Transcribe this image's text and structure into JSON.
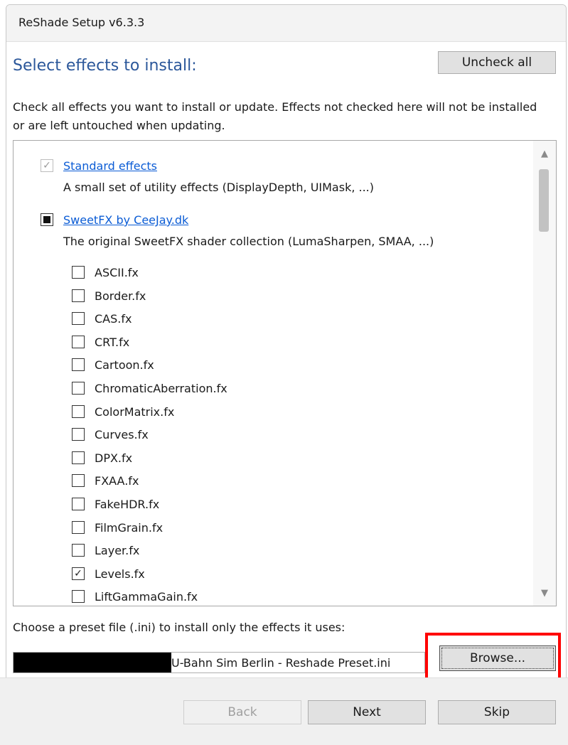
{
  "window": {
    "title": "ReShade Setup v6.3.3"
  },
  "heading": "Select effects to install:",
  "uncheck_all_label": "Uncheck all",
  "description": "Check all effects you want to install or update. Effects not checked here will not be installed or are left untouched when updating.",
  "groups": [
    {
      "name": "Standard effects",
      "description": "A small set of utility effects (DisplayDepth, UIMask, ...)",
      "state": "checked-disabled"
    },
    {
      "name": "SweetFX by CeeJay.dk",
      "description": "The original SweetFX shader collection (LumaSharpen, SMAA, ...)",
      "state": "indeterminate"
    }
  ],
  "effects": [
    {
      "label": "ASCII.fx",
      "checked": false
    },
    {
      "label": "Border.fx",
      "checked": false
    },
    {
      "label": "CAS.fx",
      "checked": false
    },
    {
      "label": "CRT.fx",
      "checked": false
    },
    {
      "label": "Cartoon.fx",
      "checked": false
    },
    {
      "label": "ChromaticAberration.fx",
      "checked": false
    },
    {
      "label": "ColorMatrix.fx",
      "checked": false
    },
    {
      "label": "Curves.fx",
      "checked": false
    },
    {
      "label": "DPX.fx",
      "checked": false
    },
    {
      "label": "FXAA.fx",
      "checked": false
    },
    {
      "label": "FakeHDR.fx",
      "checked": false
    },
    {
      "label": "FilmGrain.fx",
      "checked": false
    },
    {
      "label": "Layer.fx",
      "checked": false
    },
    {
      "label": "Levels.fx",
      "checked": true
    },
    {
      "label": "LiftGammaGain.fx",
      "checked": false
    }
  ],
  "preset": {
    "label": "Choose a preset file (.ini) to install only the effects it uses:",
    "path_visible": "U-Bahn Sim Berlin - Reshade Preset.ini",
    "browse_label": "Browse..."
  },
  "footer": {
    "back_label": "Back",
    "next_label": "Next",
    "skip_label": "Skip"
  },
  "colors": {
    "heading": "#2b579a",
    "link": "#0b5cd5",
    "highlight": "#ff0000"
  }
}
